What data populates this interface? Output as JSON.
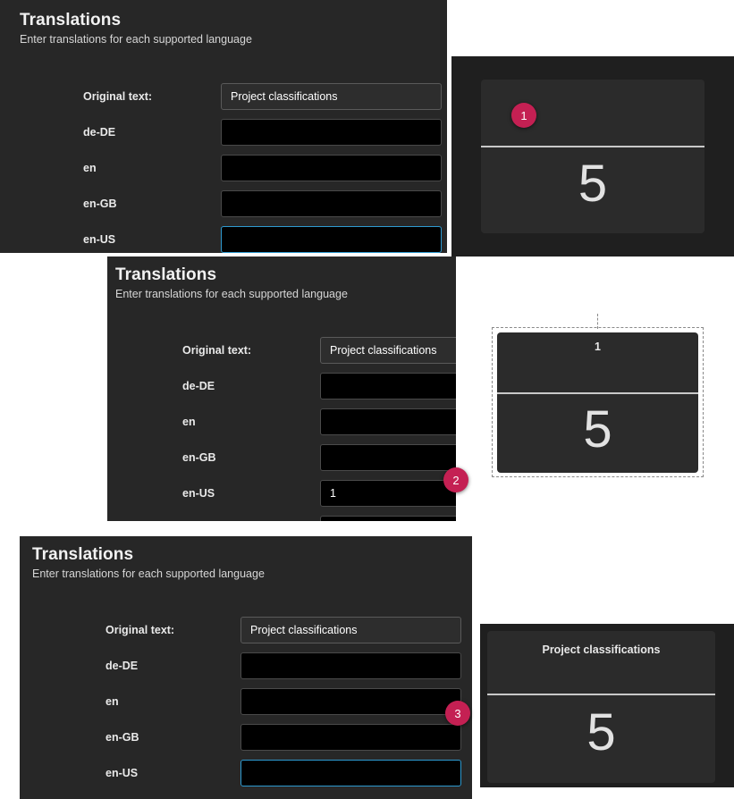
{
  "theme": {
    "page_background": "#ffffff",
    "panel_background": "#272727",
    "stage_background": "#1f1f1f",
    "tile_background": "#2b2b2b",
    "badge_color": "#c42053",
    "focus_border": "#2e9ad0",
    "rule_color": "#c9c9c9"
  },
  "dialogs": [
    {
      "title": "Translations",
      "subtitle": "Enter translations for each supported language",
      "rows": [
        {
          "label": "Original text:",
          "value": "Project classifications",
          "readonly": true,
          "focused": false
        },
        {
          "label": "de-DE",
          "value": "",
          "readonly": false,
          "focused": false
        },
        {
          "label": "en",
          "value": "",
          "readonly": false,
          "focused": false
        },
        {
          "label": "en-GB",
          "value": "",
          "readonly": false,
          "focused": false
        },
        {
          "label": "en-US",
          "value": "",
          "readonly": false,
          "focused": true
        }
      ]
    },
    {
      "title": "Translations",
      "subtitle": "Enter translations for each supported language",
      "rows": [
        {
          "label": "Original text:",
          "value": "Project classifications",
          "readonly": true,
          "focused": false
        },
        {
          "label": "de-DE",
          "value": "",
          "readonly": false,
          "focused": false
        },
        {
          "label": "en",
          "value": "",
          "readonly": false,
          "focused": false
        },
        {
          "label": "en-GB",
          "value": "",
          "readonly": false,
          "focused": false
        },
        {
          "label": "en-US",
          "value": "1",
          "readonly": false,
          "focused": false
        }
      ]
    },
    {
      "title": "Translations",
      "subtitle": "Enter translations for each supported language",
      "rows": [
        {
          "label": "Original text:",
          "value": "Project classifications",
          "readonly": true,
          "focused": false
        },
        {
          "label": "de-DE",
          "value": "",
          "readonly": false,
          "focused": false
        },
        {
          "label": "en",
          "value": "",
          "readonly": false,
          "focused": false
        },
        {
          "label": "en-GB",
          "value": "",
          "readonly": false,
          "focused": false
        },
        {
          "label": "en-US",
          "value": "",
          "readonly": false,
          "focused": true
        }
      ]
    }
  ],
  "tiles": [
    {
      "header": "",
      "value": "5",
      "selected": false
    },
    {
      "header": "1",
      "value": "5",
      "selected": true
    },
    {
      "header": "Project classifications",
      "value": "5",
      "selected": false
    }
  ],
  "badges": [
    {
      "label": "1"
    },
    {
      "label": "2"
    },
    {
      "label": "3"
    }
  ]
}
